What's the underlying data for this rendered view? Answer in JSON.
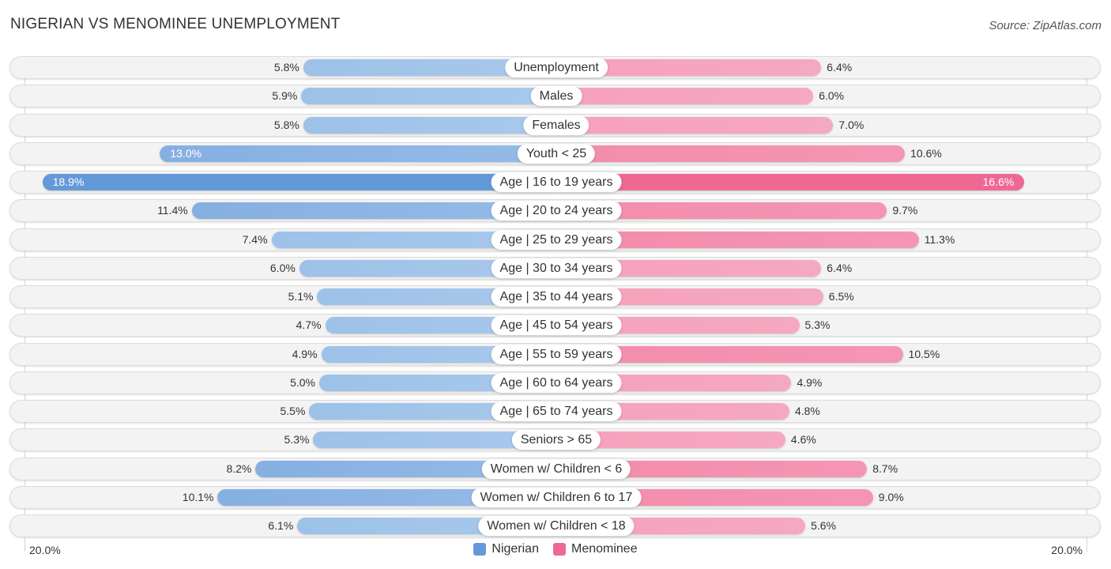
{
  "header": {
    "title": "NIGERIAN VS MENOMINEE UNEMPLOYMENT",
    "source": "Source: ZipAtlas.com"
  },
  "chart_data": {
    "type": "bar",
    "orientation": "horizontal-diverging",
    "title": "NIGERIAN VS MENOMINEE UNEMPLOYMENT",
    "xlabel": "",
    "ylabel": "",
    "unit": "%",
    "axis_min_label": "20.0%",
    "axis_max_label": "20.0%",
    "xlim": [
      0,
      20
    ],
    "legend_position": "bottom-center",
    "categories": [
      "Unemployment",
      "Males",
      "Females",
      "Youth < 25",
      "Age | 16 to 19 years",
      "Age | 20 to 24 years",
      "Age | 25 to 29 years",
      "Age | 30 to 34 years",
      "Age | 35 to 44 years",
      "Age | 45 to 54 years",
      "Age | 55 to 59 years",
      "Age | 60 to 64 years",
      "Age | 65 to 74 years",
      "Seniors > 65",
      "Women w/ Children < 6",
      "Women w/ Children 6 to 17",
      "Women w/ Children < 18"
    ],
    "series": [
      {
        "name": "Nigerian",
        "color": "#6499d9",
        "side": "left",
        "values": [
          5.8,
          5.9,
          5.8,
          13.0,
          18.9,
          11.4,
          7.4,
          6.0,
          5.1,
          4.7,
          4.9,
          5.0,
          5.5,
          5.3,
          8.2,
          10.1,
          6.1
        ]
      },
      {
        "name": "Menominee",
        "color": "#ef6894",
        "side": "right",
        "values": [
          6.4,
          6.0,
          7.0,
          10.6,
          16.6,
          9.7,
          11.3,
          6.4,
          6.5,
          5.3,
          10.5,
          4.9,
          4.8,
          4.6,
          8.7,
          9.0,
          5.6
        ]
      }
    ],
    "value_labels": {
      "Nigerian": [
        "5.8%",
        "5.9%",
        "5.8%",
        "13.0%",
        "18.9%",
        "11.4%",
        "7.4%",
        "6.0%",
        "5.1%",
        "4.7%",
        "4.9%",
        "5.0%",
        "5.5%",
        "5.3%",
        "8.2%",
        "10.1%",
        "6.1%"
      ],
      "Menominee": [
        "6.4%",
        "6.0%",
        "7.0%",
        "10.6%",
        "16.6%",
        "9.7%",
        "11.3%",
        "6.4%",
        "6.5%",
        "5.3%",
        "10.5%",
        "4.9%",
        "4.8%",
        "4.6%",
        "8.7%",
        "9.0%",
        "5.6%"
      ]
    }
  },
  "legend": {
    "items": [
      {
        "label": "Nigerian",
        "color": "#6499d9"
      },
      {
        "label": "Menominee",
        "color": "#ef6894"
      }
    ]
  }
}
